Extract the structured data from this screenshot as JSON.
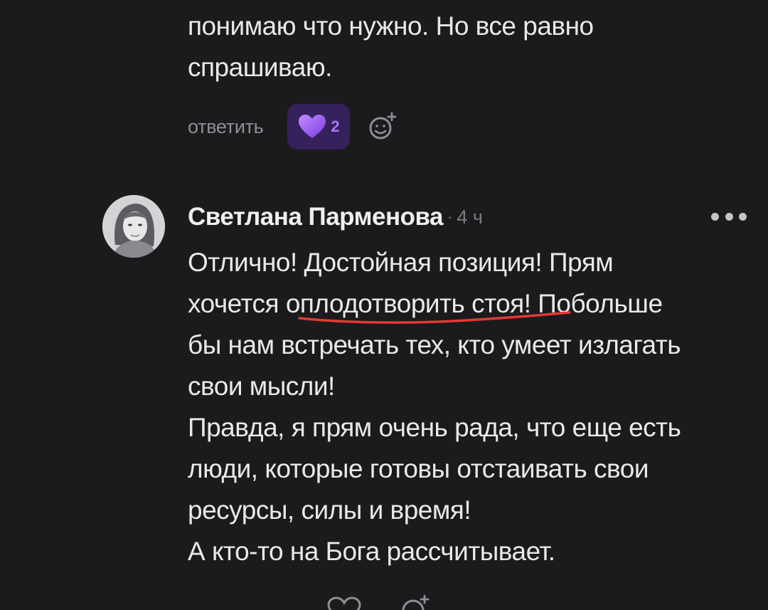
{
  "previous_comment": {
    "lines": [
      "понимаю что нужно. Но все равно",
      "спрашиваю."
    ],
    "reply_label": "ответить",
    "like_count": "2",
    "like_icon": "heart-icon",
    "reaction_icon": "add-reaction-icon"
  },
  "comment": {
    "author": "Светлана Парменова",
    "separator": "·",
    "time": "4 ч",
    "menu_icon": "more-options-icon",
    "lines": [
      "Отлично! Достойная позиция! Прям",
      "хочется оплодотворить стоя! Побольше",
      "бы нам встречать тех, кто умеет излагать",
      "свои мысли!",
      "Правда, я прям очень рада, что еще есть",
      "люди, которые готовы отстаивать свои",
      "ресурсы, силы и время!",
      "А кто-то на Бога рассчитывает."
    ],
    "highlight_color": "#e53935",
    "like_icon": "heart-outline-icon",
    "reaction_icon": "add-reaction-icon"
  },
  "colors": {
    "background": "#1b1b1d",
    "text": "#e9e9ea",
    "muted": "#8f8f93",
    "like_chip": "#35215b",
    "accent_purple": "#a77af7"
  }
}
